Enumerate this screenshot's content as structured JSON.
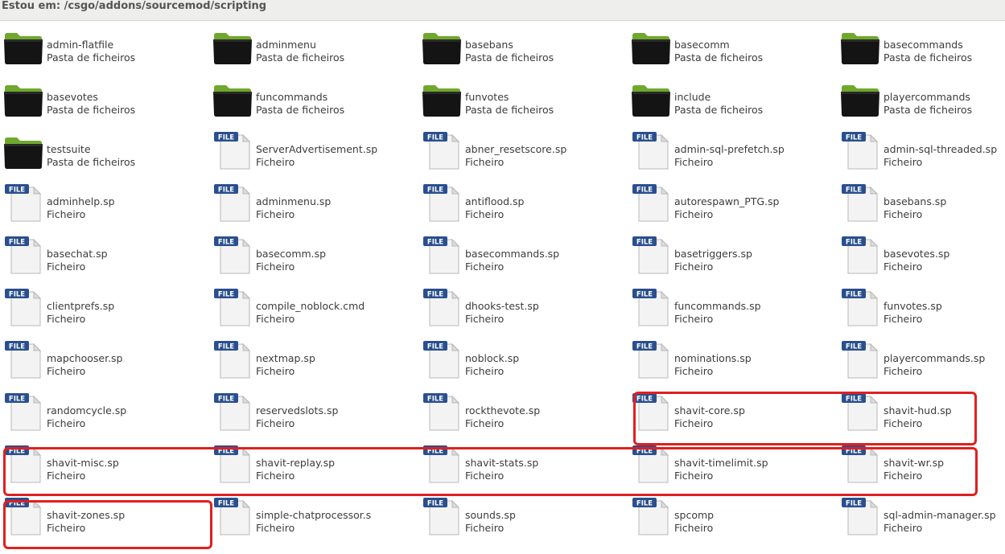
{
  "location": {
    "label": "Estou em: /csgo/addons/sourcemod/scripting"
  },
  "type_labels": {
    "folder": "Pasta de ficheiros",
    "file": "Ficheiro"
  },
  "file_badge": "FILE",
  "colors": {
    "highlight": "#e02020",
    "folder_tab": "#6fa82c",
    "file_badge": "#2a4f8f"
  },
  "items": [
    {
      "name": "admin-flatfile",
      "kind": "folder",
      "type": "Pasta de ficheiros"
    },
    {
      "name": "adminmenu",
      "kind": "folder",
      "type": "Pasta de ficheiros"
    },
    {
      "name": "basebans",
      "kind": "folder",
      "type": "Pasta de ficheiros"
    },
    {
      "name": "basecomm",
      "kind": "folder",
      "type": "Pasta de ficheiros"
    },
    {
      "name": "basecommands",
      "kind": "folder",
      "type": "Pasta de ficheiros"
    },
    {
      "name": "basevotes",
      "kind": "folder",
      "type": "Pasta de ficheiros"
    },
    {
      "name": "funcommands",
      "kind": "folder",
      "type": "Pasta de ficheiros"
    },
    {
      "name": "funvotes",
      "kind": "folder",
      "type": "Pasta de ficheiros"
    },
    {
      "name": "include",
      "kind": "folder",
      "type": "Pasta de ficheiros"
    },
    {
      "name": "playercommands",
      "kind": "folder",
      "type": "Pasta de ficheiros"
    },
    {
      "name": "testsuite",
      "kind": "folder",
      "type": "Pasta de ficheiros"
    },
    {
      "name": "ServerAdvertisement.sp",
      "kind": "file",
      "type": "Ficheiro"
    },
    {
      "name": "abner_resetscore.sp",
      "kind": "file",
      "type": "Ficheiro"
    },
    {
      "name": "admin-sql-prefetch.sp",
      "kind": "file",
      "type": "Ficheiro"
    },
    {
      "name": "admin-sql-threaded.sp",
      "kind": "file",
      "type": "Ficheiro"
    },
    {
      "name": "adminhelp.sp",
      "kind": "file",
      "type": "Ficheiro"
    },
    {
      "name": "adminmenu.sp",
      "kind": "file",
      "type": "Ficheiro"
    },
    {
      "name": "antiflood.sp",
      "kind": "file",
      "type": "Ficheiro"
    },
    {
      "name": "autorespawn_PTG.sp",
      "kind": "file",
      "type": "Ficheiro"
    },
    {
      "name": "basebans.sp",
      "kind": "file",
      "type": "Ficheiro"
    },
    {
      "name": "basechat.sp",
      "kind": "file",
      "type": "Ficheiro"
    },
    {
      "name": "basecomm.sp",
      "kind": "file",
      "type": "Ficheiro"
    },
    {
      "name": "basecommands.sp",
      "kind": "file",
      "type": "Ficheiro"
    },
    {
      "name": "basetriggers.sp",
      "kind": "file",
      "type": "Ficheiro"
    },
    {
      "name": "basevotes.sp",
      "kind": "file",
      "type": "Ficheiro"
    },
    {
      "name": "clientprefs.sp",
      "kind": "file",
      "type": "Ficheiro"
    },
    {
      "name": "compile_noblock.cmd",
      "kind": "file",
      "type": "Ficheiro"
    },
    {
      "name": "dhooks-test.sp",
      "kind": "file",
      "type": "Ficheiro"
    },
    {
      "name": "funcommands.sp",
      "kind": "file",
      "type": "Ficheiro"
    },
    {
      "name": "funvotes.sp",
      "kind": "file",
      "type": "Ficheiro"
    },
    {
      "name": "mapchooser.sp",
      "kind": "file",
      "type": "Ficheiro"
    },
    {
      "name": "nextmap.sp",
      "kind": "file",
      "type": "Ficheiro"
    },
    {
      "name": "noblock.sp",
      "kind": "file",
      "type": "Ficheiro"
    },
    {
      "name": "nominations.sp",
      "kind": "file",
      "type": "Ficheiro"
    },
    {
      "name": "playercommands.sp",
      "kind": "file",
      "type": "Ficheiro"
    },
    {
      "name": "randomcycle.sp",
      "kind": "file",
      "type": "Ficheiro"
    },
    {
      "name": "reservedslots.sp",
      "kind": "file",
      "type": "Ficheiro"
    },
    {
      "name": "rockthevote.sp",
      "kind": "file",
      "type": "Ficheiro"
    },
    {
      "name": "shavit-core.sp",
      "kind": "file",
      "type": "Ficheiro"
    },
    {
      "name": "shavit-hud.sp",
      "kind": "file",
      "type": "Ficheiro"
    },
    {
      "name": "shavit-misc.sp",
      "kind": "file",
      "type": "Ficheiro"
    },
    {
      "name": "shavit-replay.sp",
      "kind": "file",
      "type": "Ficheiro"
    },
    {
      "name": "shavit-stats.sp",
      "kind": "file",
      "type": "Ficheiro"
    },
    {
      "name": "shavit-timelimit.sp",
      "kind": "file",
      "type": "Ficheiro"
    },
    {
      "name": "shavit-wr.sp",
      "kind": "file",
      "type": "Ficheiro"
    },
    {
      "name": "shavit-zones.sp",
      "kind": "file",
      "type": "Ficheiro"
    },
    {
      "name": "simple-chatprocessor.s",
      "kind": "file",
      "type": "Ficheiro"
    },
    {
      "name": "sounds.sp",
      "kind": "file",
      "type": "Ficheiro"
    },
    {
      "name": "spcomp",
      "kind": "file",
      "type": "Ficheiro"
    },
    {
      "name": "sql-admin-manager.sp",
      "kind": "file",
      "type": "Ficheiro"
    }
  ]
}
